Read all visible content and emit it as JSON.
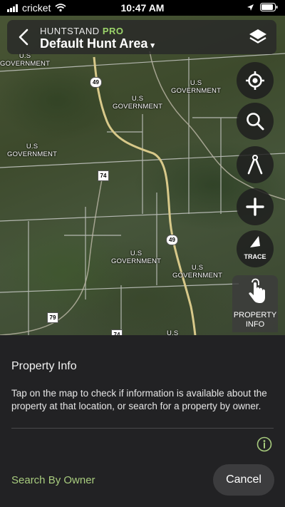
{
  "status_bar": {
    "carrier": "cricket",
    "time": "10:47 AM"
  },
  "header": {
    "brand": "HUNTSTAND",
    "brand_tier": "PRO",
    "area_name": "Default Hunt Area",
    "caret": "▾"
  },
  "map": {
    "labels": [
      {
        "text": "U.S\nGOVERNMENT"
      },
      {
        "text": "U.S\nGOVERNMENT"
      },
      {
        "text": "U.S\nGOVERNMENT"
      },
      {
        "text": "U.S\nGOVERNMENT"
      },
      {
        "text": "U.S\nGOVERNMENT"
      },
      {
        "text": "U.S\nGOVERNMENT"
      },
      {
        "text": "U.S"
      }
    ],
    "shields": [
      "49",
      "74",
      "49",
      "79",
      "74"
    ]
  },
  "tools": {
    "trace_label": "TRACE",
    "property_info_label": "PROPERTY\nINFO"
  },
  "sheet": {
    "title": "Property Info",
    "body": "Tap on the map to check if information is available about the property at that location, or search for a property by owner.",
    "search_owner_label": "Search By Owner",
    "cancel_label": "Cancel"
  },
  "colors": {
    "accent_green": "#a8cc7e",
    "pro_green": "#9bd36a",
    "sheet_bg": "#222224"
  }
}
